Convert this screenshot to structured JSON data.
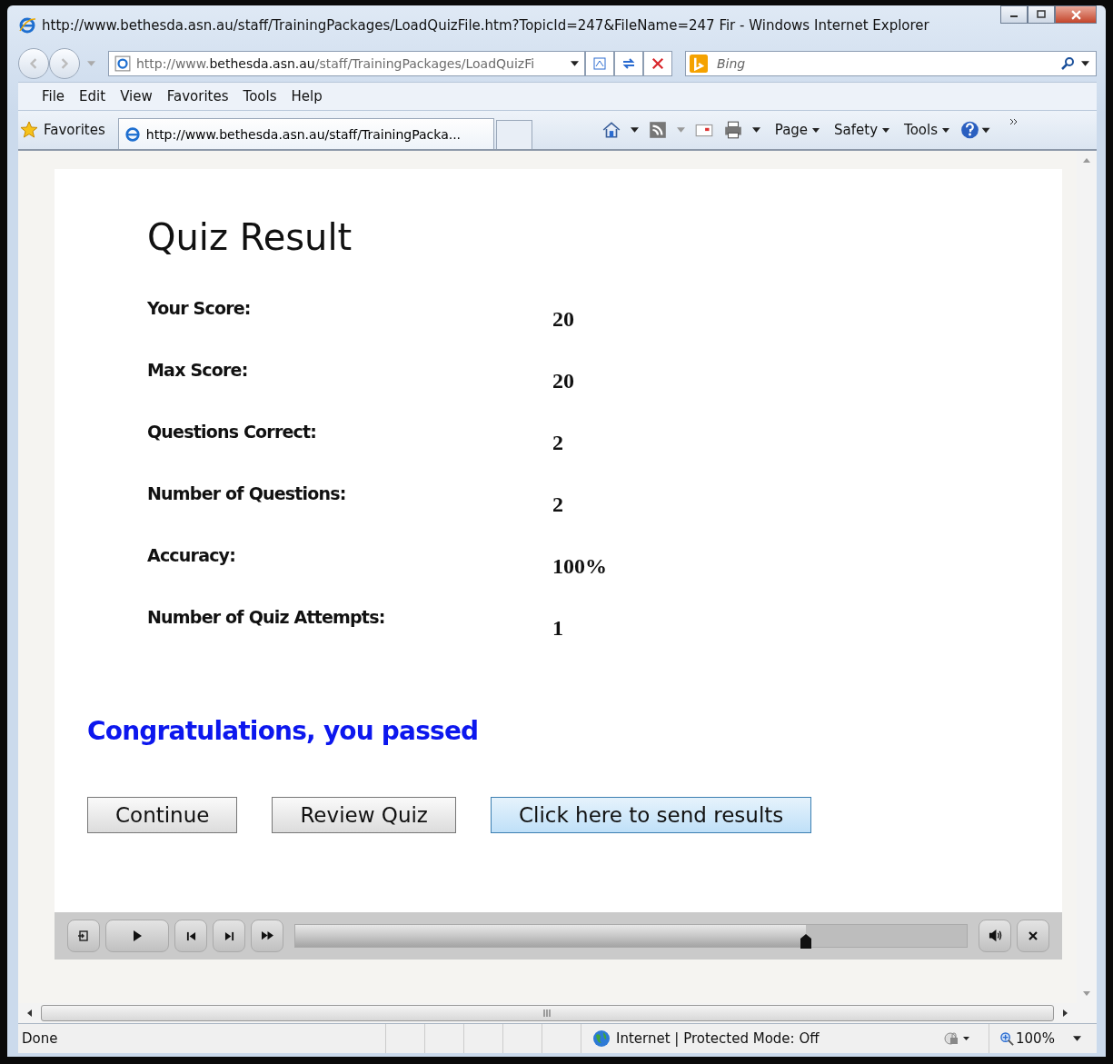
{
  "window": {
    "title": "http://www.bethesda.asn.au/staff/TrainingPackages/LoadQuizFile.htm?TopicId=247&FileName=247 Fir - Windows Internet Explorer"
  },
  "address_bar": {
    "value_host": "http://www.",
    "value_domain": "bethesda.asn.au",
    "value_path": "/staff/TrainingPackages/LoadQuizFi"
  },
  "search": {
    "placeholder": "Bing"
  },
  "menu": [
    "File",
    "Edit",
    "View",
    "Favorites",
    "Tools",
    "Help"
  ],
  "favorites_button": "Favorites",
  "tabs": [
    {
      "label": "http://www.bethesda.asn.au/staff/TrainingPacka...",
      "selected": true
    }
  ],
  "command_bar": [
    "Page",
    "Safety",
    "Tools"
  ],
  "quiz": {
    "title": "Quiz Result",
    "rows": [
      {
        "label": "Your Score:",
        "value": "20"
      },
      {
        "label": "Max Score:",
        "value": "20"
      },
      {
        "label": "Questions Correct:",
        "value": "2"
      },
      {
        "label": "Number of Questions:",
        "value": "2"
      },
      {
        "label": "Accuracy:",
        "value": "100%"
      },
      {
        "label": "Number of Quiz Attempts:",
        "value": "1"
      }
    ],
    "message": "Congratulations, you passed",
    "buttons": [
      {
        "label": "Continue",
        "kind": "plain"
      },
      {
        "label": "Review Quiz",
        "kind": "plain"
      },
      {
        "label": "Click here to send results",
        "kind": "highlight"
      }
    ]
  },
  "player": {
    "level": 0.76
  },
  "status_bar": {
    "status": "Done",
    "zone": "Internet | Protected Mode: Off",
    "zoom": "100%"
  }
}
